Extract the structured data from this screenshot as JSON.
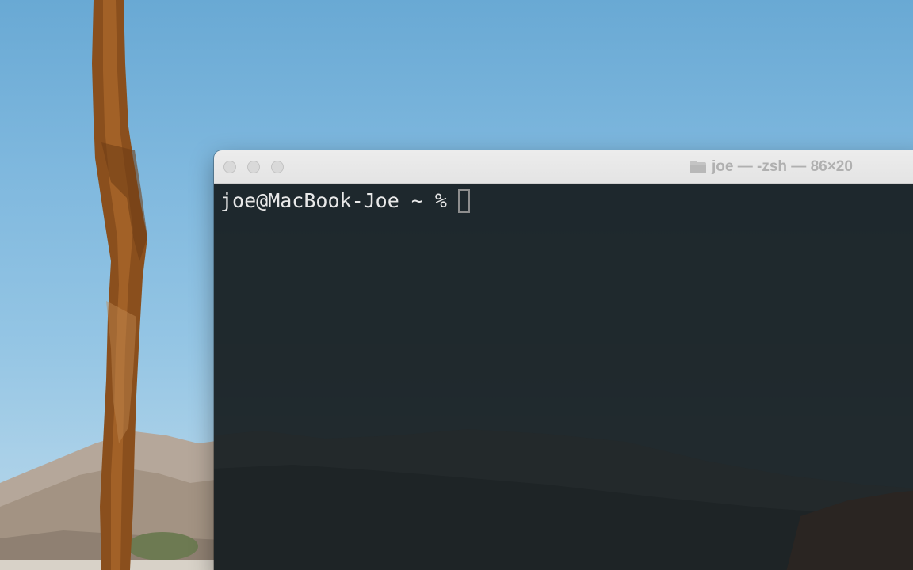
{
  "window": {
    "title": "joe — -zsh — 86×20"
  },
  "terminal": {
    "prompt": "joe@MacBook-Joe ~ %"
  },
  "icons": {
    "folder": "folder-icon",
    "close": "close-button",
    "minimize": "minimize-button",
    "zoom": "zoom-button"
  },
  "colors": {
    "sky": "#7fb8de",
    "terminal_bg": "#171d1f",
    "titlebar": "#e8e8e8",
    "title_text": "#b0b0b0",
    "prompt_text": "#e8e8e8"
  }
}
